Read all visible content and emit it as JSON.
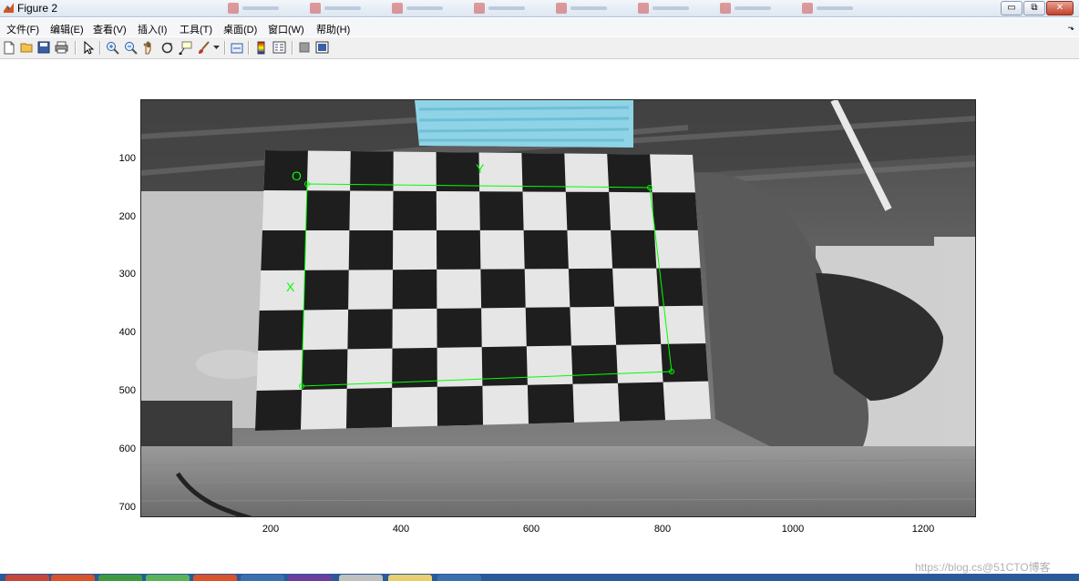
{
  "window": {
    "title": "Figure 2",
    "buttons": {
      "minimize": "▭",
      "maximize": "⧉",
      "close": "✕"
    }
  },
  "menubar": {
    "items": [
      {
        "label": "文件(F)"
      },
      {
        "label": "编辑(E)"
      },
      {
        "label": "查看(V)"
      },
      {
        "label": "插入(I)"
      },
      {
        "label": "工具(T)"
      },
      {
        "label": "桌面(D)"
      },
      {
        "label": "窗口(W)"
      },
      {
        "label": "帮助(H)"
      }
    ],
    "overflow_arrow": "⬎"
  },
  "toolbar": {
    "icons": [
      "new-figure-icon",
      "open-file-icon",
      "save-icon",
      "print-icon",
      "pointer-icon",
      "zoom-in-icon",
      "zoom-out-icon",
      "pan-icon",
      "rotate-3d-icon",
      "data-cursor-icon",
      "brush-icon",
      "link-plot-icon",
      "colorbar-icon",
      "legend-icon",
      "hide-plot-tools-icon",
      "show-plot-tools-icon"
    ]
  },
  "plot": {
    "y_ticks": [
      "100",
      "200",
      "300",
      "400",
      "500",
      "600",
      "700"
    ],
    "x_ticks": [
      "200",
      "400",
      "600",
      "800",
      "1000",
      "1200"
    ],
    "labels": {
      "origin": "O",
      "x_axis": "X",
      "y_axis": "Y"
    },
    "overlay_color": "#00ff00",
    "redaction_color": "#8fd3e6",
    "checkerboard": {
      "cols": 10,
      "rows": 7
    }
  },
  "watermark": "https://blog.cs@51CTO博客"
}
